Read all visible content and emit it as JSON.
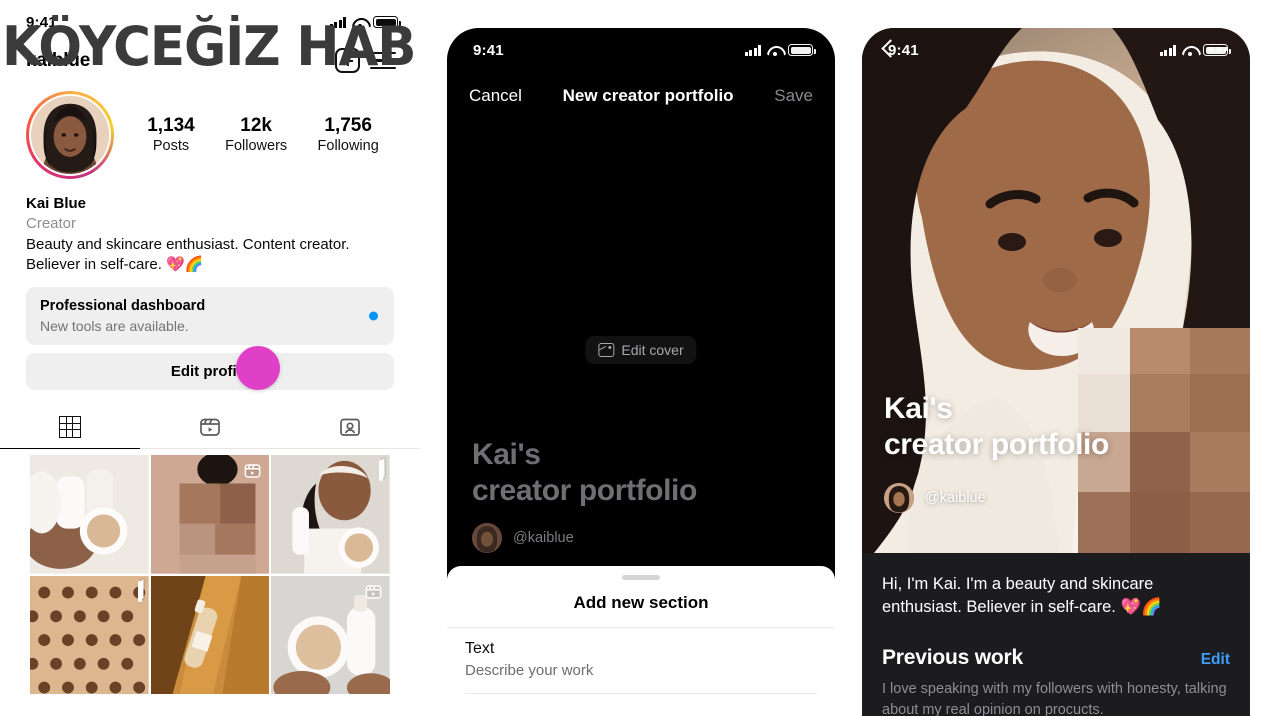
{
  "watermark": {
    "text": "KÖYCEĞİZ HABER"
  },
  "profile_panel": {
    "status_bar": {
      "time": "9:41",
      "signal_icon": "cellular-signal-icon",
      "wifi_icon": "wifi-icon",
      "battery_icon": "battery-icon"
    },
    "header": {
      "username": "kaiblue",
      "new_post_icon": "plus-square-icon",
      "menu_icon": "hamburger-menu-icon"
    },
    "avatar": {
      "name": "profile-avatar",
      "has_story_ring": true
    },
    "stats": [
      {
        "value": "1,134",
        "label": "Posts"
      },
      {
        "value": "12k",
        "label": "Followers"
      },
      {
        "value": "1,756",
        "label": "Following"
      }
    ],
    "bio": {
      "name": "Kai Blue",
      "category": "Creator",
      "text": "Beauty and skincare enthusiast. Content creator. Believer in self-care. 💖🌈"
    },
    "dashboard_card": {
      "title": "Professional dashboard",
      "subtitle": "New tools are available.",
      "badge": "notification-dot",
      "badge_color": "#0095f6"
    },
    "edit_profile_label": "Edit profile",
    "tabs": [
      {
        "name": "grid",
        "icon": "grid-icon",
        "active": true
      },
      {
        "name": "reels",
        "icon": "reels-icon",
        "active": false
      },
      {
        "name": "tagged",
        "icon": "tagged-icon",
        "active": false
      }
    ],
    "grid_tiles": [
      {
        "badge": null
      },
      {
        "badge": "reels-icon"
      },
      {
        "badge": "carousel-icon"
      },
      {
        "badge": "carousel-icon"
      },
      {
        "badge": null
      },
      {
        "badge": "reels-icon"
      }
    ],
    "cursor": {
      "name": "click-indicator",
      "color": "#e040c8"
    }
  },
  "editor_panel": {
    "status_bar": {
      "time": "9:41"
    },
    "nav": {
      "cancel": "Cancel",
      "title": "New creator portfolio",
      "save": "Save"
    },
    "cover": {
      "edit_cover_label": "Edit cover",
      "edit_cover_icon": "image-icon",
      "title_line1": "Kai's",
      "title_line2": "creator portfolio",
      "handle": "@kaiblue"
    },
    "sheet": {
      "title": "Add new section",
      "rows": [
        {
          "title": "Text",
          "subtitle": "Describe your work"
        }
      ]
    }
  },
  "preview_panel": {
    "status_bar": {
      "time": "9:41"
    },
    "nav": {
      "back_icon": "chevron-left-icon",
      "more_icon": "more-options-icon"
    },
    "cover": {
      "title_line1": "Kai's",
      "title_line2": "creator portfolio",
      "handle": "@kaiblue"
    },
    "bio": "Hi, I'm Kai. I'm a beauty and skincare enthusiast. Believer in self-care. 💖🌈",
    "section": {
      "heading": "Previous work",
      "edit_label": "Edit",
      "body": "I love speaking with my followers with honesty, talking about my real opinion on procucts."
    }
  }
}
